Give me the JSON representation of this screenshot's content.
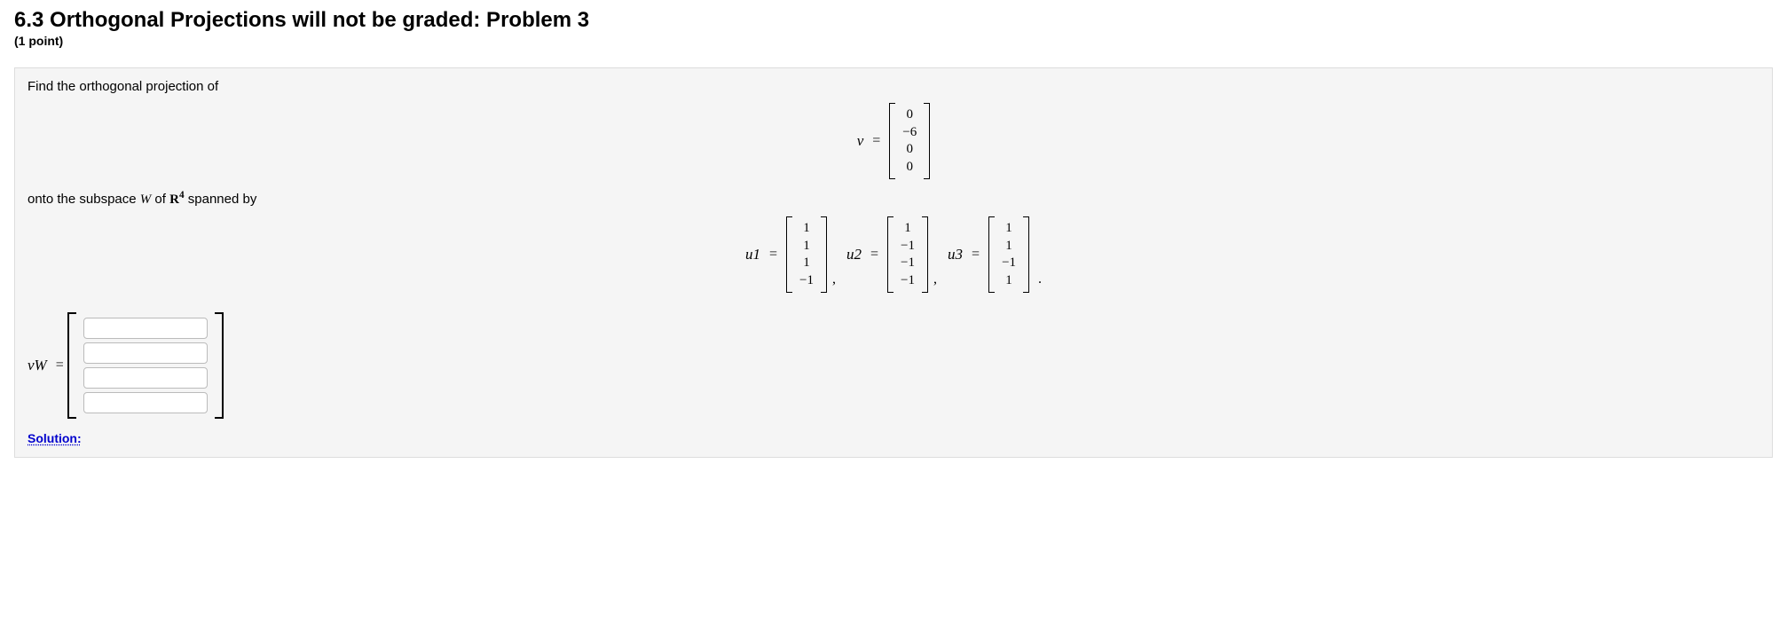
{
  "header": {
    "title": "6.3 Orthogonal Projections will not be graded: Problem 3",
    "points": "(1 point)"
  },
  "problem": {
    "prompt1": "Find the orthogonal projection of",
    "v_label": "v",
    "eq": "=",
    "v": [
      "0",
      "−6",
      "0",
      "0"
    ],
    "prompt2_a": "onto the subspace ",
    "W": "W",
    "prompt2_b": " of ",
    "R": "R",
    "R_exp": "4",
    "prompt2_c": " spanned by",
    "u1_label": "u1",
    "u1": [
      "1",
      "1",
      "1",
      "−1"
    ],
    "u2_label": "u2",
    "u2": [
      "1",
      "−1",
      "−1",
      "−1"
    ],
    "u3_label": "u3",
    "u3": [
      "1",
      "1",
      "−1",
      "1"
    ],
    "answer_label": "vW",
    "solution_label": "Solution:"
  }
}
